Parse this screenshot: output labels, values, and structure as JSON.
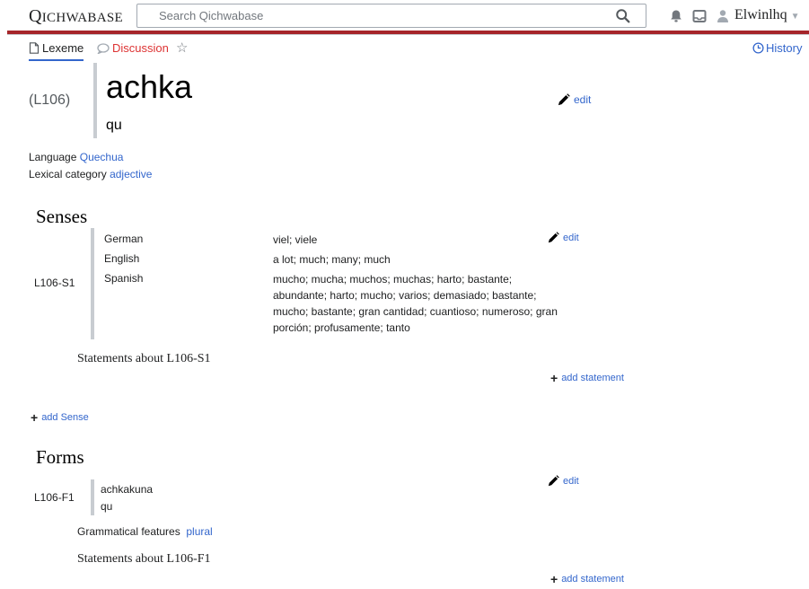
{
  "header": {
    "logo": "Qichwabase",
    "search_placeholder": "Search Qichwabase",
    "username": "Elwinlhq"
  },
  "tabs": {
    "lexeme": "Lexeme",
    "discussion": "Discussion",
    "history": "History"
  },
  "lexeme": {
    "id": "(L106)",
    "lemma": "achka",
    "lemma_lang": "qu",
    "edit_label": "edit",
    "language_label": "Language",
    "language_value": "Quechua",
    "category_label": "Lexical category",
    "category_value": "adjective"
  },
  "senses": {
    "heading": "Senses",
    "sense_id": "L106-S1",
    "edit_label": "edit",
    "glosses": [
      {
        "lang": "German",
        "text": "viel; viele"
      },
      {
        "lang": "English",
        "text": "a lot; much; many; much"
      },
      {
        "lang": "Spanish",
        "text": "mucho; mucha; muchos; muchas; harto; bastante; abundante; harto; mucho; varios; demasiado; bastante; mucho; bastante; gran cantidad; cuantioso; numeroso; gran porción; profusamente; tanto"
      }
    ],
    "statements_heading": "Statements about L106-S1",
    "add_statement": "add statement",
    "add_sense": "add Sense"
  },
  "forms": {
    "heading": "Forms",
    "form_id": "L106-F1",
    "representation": "achkakuna",
    "representation_lang": "qu",
    "edit_label": "edit",
    "grammatical_label": "Grammatical features",
    "grammatical_value": "plural",
    "statements_heading": "Statements about L106-F1",
    "add_statement": "add statement"
  }
}
